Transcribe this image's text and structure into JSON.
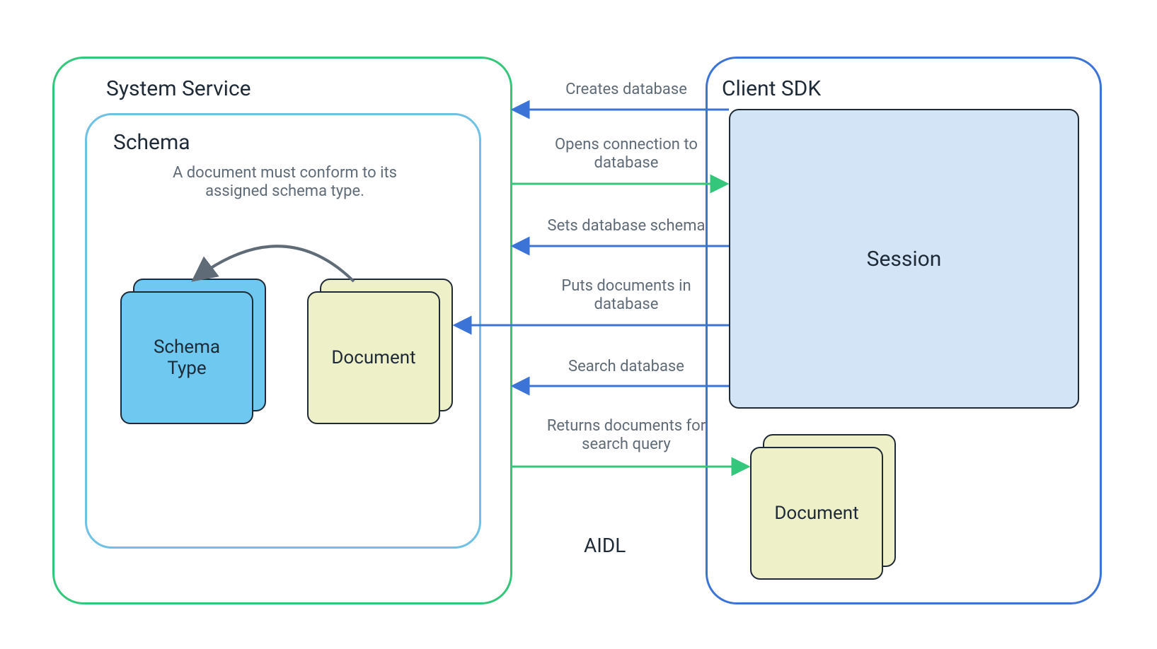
{
  "colors": {
    "green": "#34c77b",
    "blue": "#3b73d6",
    "lightBlueBorder": "#6ec1e4",
    "darkText": "#1f2a37",
    "grayText": "#5f6b76",
    "schemaTypeFill": "#6ec8ef",
    "documentFill": "#eef0c8",
    "sessionFill": "#d3e4f7",
    "arrowGray": "#5f6b76"
  },
  "systemService": {
    "title": "System Service"
  },
  "schema": {
    "title": "Schema",
    "note": "A document must conform to its\nassigned schema type.",
    "schemaTypeLabel": "Schema\nType",
    "documentLabel": "Document"
  },
  "clientSdk": {
    "title": "Client SDK",
    "sessionLabel": "Session",
    "documentLabel": "Document"
  },
  "aidlLabel": "AIDL",
  "arrows": [
    {
      "label": "Creates database",
      "dir": "left",
      "color": "blue"
    },
    {
      "label": "Opens connection to\ndatabase",
      "dir": "right",
      "color": "green"
    },
    {
      "label": "Sets database schema",
      "dir": "left",
      "color": "blue"
    },
    {
      "label": "Puts documents in\ndatabase",
      "dir": "left",
      "color": "blue"
    },
    {
      "label": "Search database",
      "dir": "left",
      "color": "blue"
    },
    {
      "label": "Returns documents for\nsearch query",
      "dir": "right",
      "color": "green"
    }
  ]
}
